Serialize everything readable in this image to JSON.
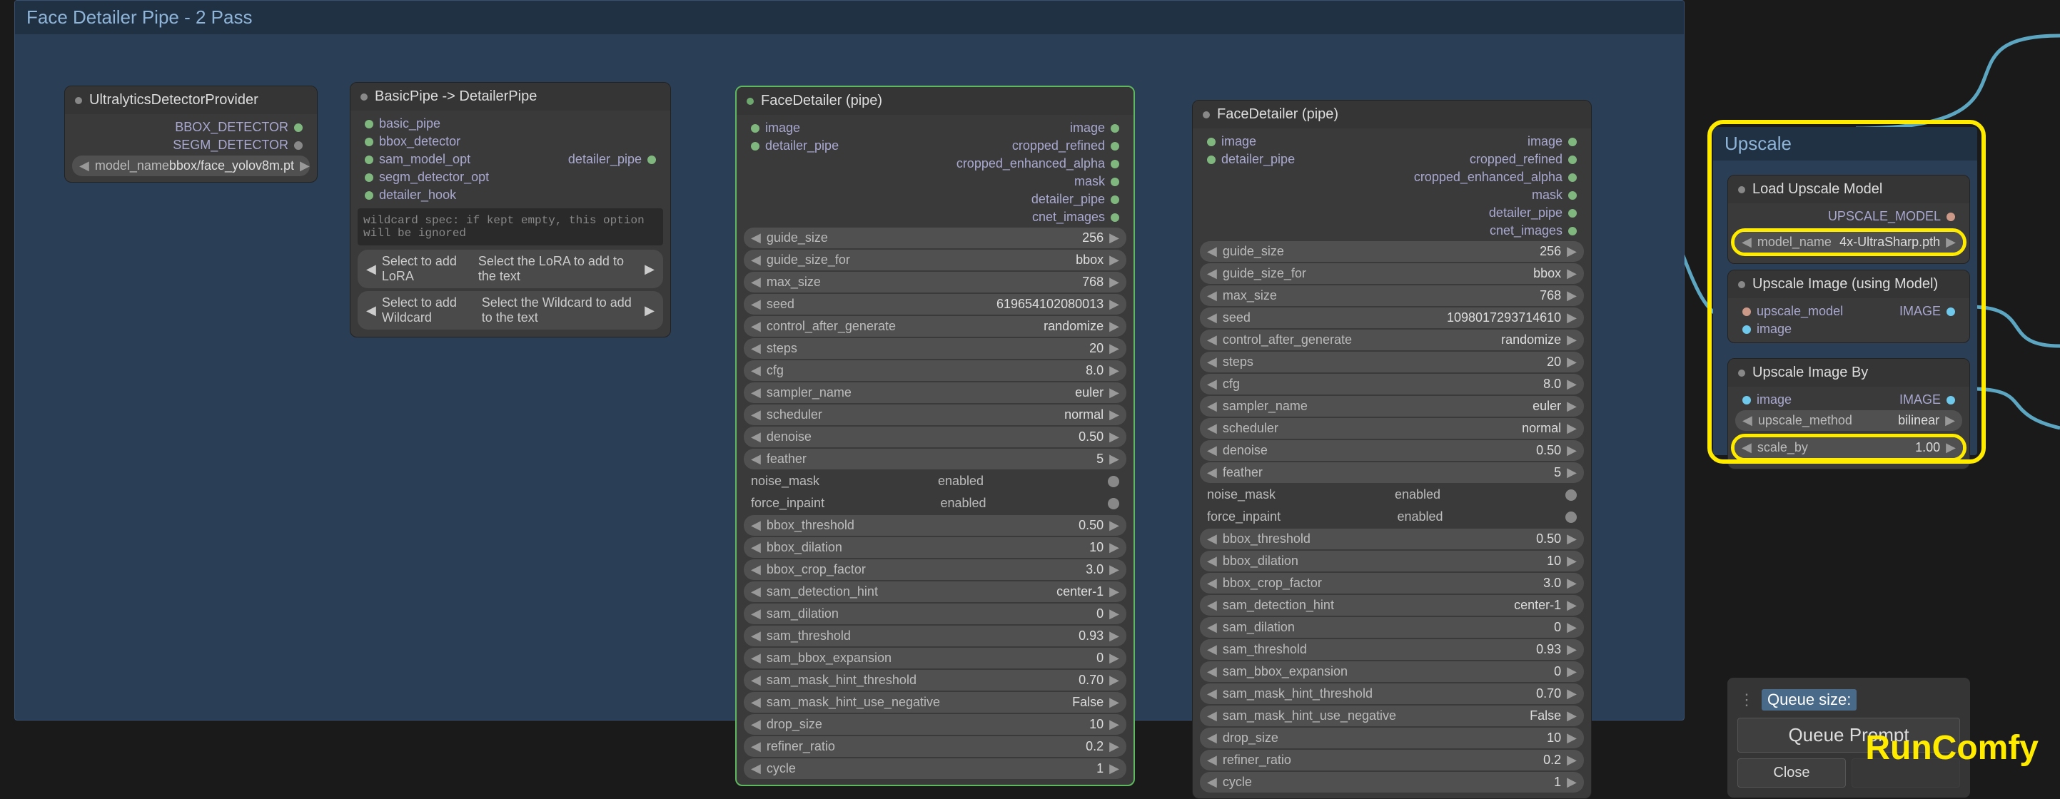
{
  "group": {
    "title": "Face Detailer Pipe - 2 Pass"
  },
  "upscale_group": {
    "title": "Upscale"
  },
  "node_ultra": {
    "title": "UltralyticsDetectorProvider",
    "out1": "BBOX_DETECTOR",
    "out2": "SEGM_DETECTOR",
    "p_model_name": {
      "label": "model_name",
      "value": "bbox/face_yolov8m.pt"
    }
  },
  "node_basic": {
    "title": "BasicPipe -> DetailerPipe",
    "in": [
      "basic_pipe",
      "bbox_detector",
      "sam_model_opt",
      "segm_detector_opt",
      "detailer_hook"
    ],
    "out": "detailer_pipe",
    "wildcard": "wildcard spec: if kept empty, this option will be ignored",
    "lora": {
      "l": "Select to add LoRA",
      "r": "Select the LoRA to add to the text"
    },
    "wild": {
      "l": "Select to add Wildcard",
      "r": "Select the Wildcard to add to the text"
    }
  },
  "fd1": {
    "title": "FaceDetailer (pipe)",
    "in": [
      "image",
      "detailer_pipe"
    ],
    "out": [
      "image",
      "cropped_refined",
      "cropped_enhanced_alpha",
      "mask",
      "detailer_pipe",
      "cnet_images"
    ],
    "params": [
      {
        "label": "guide_size",
        "value": "256"
      },
      {
        "label": "guide_size_for",
        "value": "bbox"
      },
      {
        "label": "max_size",
        "value": "768"
      },
      {
        "label": "seed",
        "value": "619654102080013"
      },
      {
        "label": "control_after_generate",
        "value": "randomize"
      },
      {
        "label": "steps",
        "value": "20"
      },
      {
        "label": "cfg",
        "value": "8.0"
      },
      {
        "label": "sampler_name",
        "value": "euler"
      },
      {
        "label": "scheduler",
        "value": "normal"
      },
      {
        "label": "denoise",
        "value": "0.50"
      },
      {
        "label": "feather",
        "value": "5"
      }
    ],
    "toggles": [
      {
        "label": "noise_mask",
        "value": "enabled"
      },
      {
        "label": "force_inpaint",
        "value": "enabled"
      }
    ],
    "params2": [
      {
        "label": "bbox_threshold",
        "value": "0.50"
      },
      {
        "label": "bbox_dilation",
        "value": "10"
      },
      {
        "label": "bbox_crop_factor",
        "value": "3.0"
      },
      {
        "label": "sam_detection_hint",
        "value": "center-1"
      },
      {
        "label": "sam_dilation",
        "value": "0"
      },
      {
        "label": "sam_threshold",
        "value": "0.93"
      },
      {
        "label": "sam_bbox_expansion",
        "value": "0"
      },
      {
        "label": "sam_mask_hint_threshold",
        "value": "0.70"
      },
      {
        "label": "sam_mask_hint_use_negative",
        "value": "False"
      },
      {
        "label": "drop_size",
        "value": "10"
      },
      {
        "label": "refiner_ratio",
        "value": "0.2"
      },
      {
        "label": "cycle",
        "value": "1"
      }
    ]
  },
  "fd2": {
    "title": "FaceDetailer (pipe)",
    "in": [
      "image",
      "detailer_pipe"
    ],
    "out": [
      "image",
      "cropped_refined",
      "cropped_enhanced_alpha",
      "mask",
      "detailer_pipe",
      "cnet_images"
    ],
    "params": [
      {
        "label": "guide_size",
        "value": "256"
      },
      {
        "label": "guide_size_for",
        "value": "bbox"
      },
      {
        "label": "max_size",
        "value": "768"
      },
      {
        "label": "seed",
        "value": "1098017293714610"
      },
      {
        "label": "control_after_generate",
        "value": "randomize"
      },
      {
        "label": "steps",
        "value": "20"
      },
      {
        "label": "cfg",
        "value": "8.0"
      },
      {
        "label": "sampler_name",
        "value": "euler"
      },
      {
        "label": "scheduler",
        "value": "normal"
      },
      {
        "label": "denoise",
        "value": "0.50"
      },
      {
        "label": "feather",
        "value": "5"
      }
    ],
    "toggles": [
      {
        "label": "noise_mask",
        "value": "enabled"
      },
      {
        "label": "force_inpaint",
        "value": "enabled"
      }
    ],
    "params2": [
      {
        "label": "bbox_threshold",
        "value": "0.50"
      },
      {
        "label": "bbox_dilation",
        "value": "10"
      },
      {
        "label": "bbox_crop_factor",
        "value": "3.0"
      },
      {
        "label": "sam_detection_hint",
        "value": "center-1"
      },
      {
        "label": "sam_dilation",
        "value": "0"
      },
      {
        "label": "sam_threshold",
        "value": "0.93"
      },
      {
        "label": "sam_bbox_expansion",
        "value": "0"
      },
      {
        "label": "sam_mask_hint_threshold",
        "value": "0.70"
      },
      {
        "label": "sam_mask_hint_use_negative",
        "value": "False"
      },
      {
        "label": "drop_size",
        "value": "10"
      },
      {
        "label": "refiner_ratio",
        "value": "0.2"
      },
      {
        "label": "cycle",
        "value": "1"
      }
    ]
  },
  "load_up": {
    "title": "Load Upscale Model",
    "out": "UPSCALE_MODEL",
    "p": {
      "label": "model_name",
      "value": "4x-UltraSharp.pth"
    }
  },
  "up_model": {
    "title": "Upscale Image (using Model)",
    "in": [
      "upscale_model",
      "image"
    ],
    "out": "IMAGE"
  },
  "up_by": {
    "title": "Upscale Image By",
    "in": "image",
    "out": "IMAGE",
    "p1": {
      "label": "upscale_method",
      "value": "bilinear"
    },
    "p2": {
      "label": "scale_by",
      "value": "1.00"
    }
  },
  "queue": {
    "size_label": "Queue size:",
    "size_val": "",
    "prompt": "Queue Prompt",
    "close": "Close"
  },
  "watermark": "RunComfy"
}
